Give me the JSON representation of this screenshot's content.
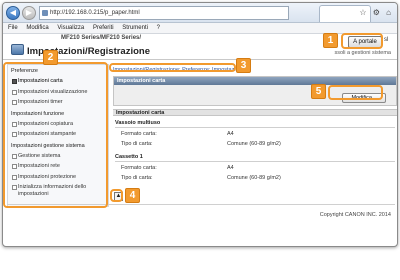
{
  "browser": {
    "url": "http://192.168.0.215/p_paper.html",
    "menu": [
      "File",
      "Modifica",
      "Visualizza",
      "Preferiti",
      "Strumenti",
      "?"
    ],
    "toolbar_glyphs": "☆ ⚙ ⌂",
    "nav_back": "◀",
    "nav_fwd": "▶",
    "window_icons": "_ □ ✕"
  },
  "header": {
    "model": "MF210 Series/MF210 Series/",
    "title": "Impostazioni/Registrazione",
    "portal_button": "A portale",
    "portal_tail": "sl",
    "user_info": "ssoli a gestioni sistema"
  },
  "sidebar": {
    "sections": [
      {
        "title": "Preferenze",
        "items": [
          {
            "label": "Impostazioni carta",
            "active": true
          },
          {
            "label": "Impostazioni visualizzazione",
            "active": false
          },
          {
            "label": "Impostazioni timer",
            "active": false
          }
        ]
      },
      {
        "title": "Impostazioni funzione",
        "items": [
          {
            "label": "Impostazioni copiatura",
            "active": false
          },
          {
            "label": "Impostazioni stampante",
            "active": false
          }
        ]
      },
      {
        "title": "Impostazioni gestione sistema",
        "items": [
          {
            "label": "Gestione sistema",
            "active": false
          },
          {
            "label": "Impostazioni rete",
            "active": false
          },
          {
            "label": "Impostazioni protezione",
            "active": false
          },
          {
            "label": "Inizializza informazioni dello impostazioni",
            "active": false
          }
        ]
      }
    ]
  },
  "main": {
    "breadcrumb": "Impostazioni/Registrazione: Preferenze: Impostazioni",
    "panel_title": "Impostazioni carta",
    "modify_button": "Modifica...",
    "section_title": "Impostazioni carta",
    "groups": [
      {
        "title": "Vassoio multiuso",
        "rows": [
          {
            "label": "Formato carta:",
            "value": "A4"
          },
          {
            "label": "Tipo di carta:",
            "value": "Comune (60-89 g/m2)"
          }
        ]
      },
      {
        "title": "Cassetto 1",
        "rows": [
          {
            "label": "Formato carta:",
            "value": "A4"
          },
          {
            "label": "Tipo di carta:",
            "value": "Comune (60-89 g/m2)"
          }
        ]
      }
    ],
    "top_button": "▲",
    "copyright": "Copyright CANON INC. 2014"
  },
  "callouts": [
    "1",
    "2",
    "3",
    "4",
    "5"
  ],
  "colors": {
    "callout": "#f29a2e",
    "panel_header": "#5f7896",
    "link": "#2d55a0"
  }
}
